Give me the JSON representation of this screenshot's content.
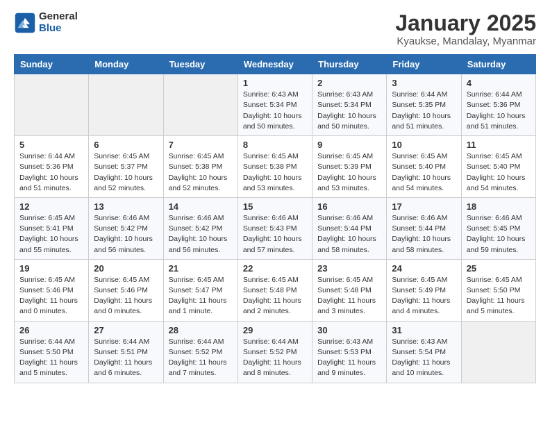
{
  "header": {
    "logo_general": "General",
    "logo_blue": "Blue",
    "month_year": "January 2025",
    "location": "Kyaukse, Mandalay, Myanmar"
  },
  "days_of_week": [
    "Sunday",
    "Monday",
    "Tuesday",
    "Wednesday",
    "Thursday",
    "Friday",
    "Saturday"
  ],
  "weeks": [
    [
      {
        "day": "",
        "info": ""
      },
      {
        "day": "",
        "info": ""
      },
      {
        "day": "",
        "info": ""
      },
      {
        "day": "1",
        "info": "Sunrise: 6:43 AM\nSunset: 5:34 PM\nDaylight: 10 hours\nand 50 minutes."
      },
      {
        "day": "2",
        "info": "Sunrise: 6:43 AM\nSunset: 5:34 PM\nDaylight: 10 hours\nand 50 minutes."
      },
      {
        "day": "3",
        "info": "Sunrise: 6:44 AM\nSunset: 5:35 PM\nDaylight: 10 hours\nand 51 minutes."
      },
      {
        "day": "4",
        "info": "Sunrise: 6:44 AM\nSunset: 5:36 PM\nDaylight: 10 hours\nand 51 minutes."
      }
    ],
    [
      {
        "day": "5",
        "info": "Sunrise: 6:44 AM\nSunset: 5:36 PM\nDaylight: 10 hours\nand 51 minutes."
      },
      {
        "day": "6",
        "info": "Sunrise: 6:45 AM\nSunset: 5:37 PM\nDaylight: 10 hours\nand 52 minutes."
      },
      {
        "day": "7",
        "info": "Sunrise: 6:45 AM\nSunset: 5:38 PM\nDaylight: 10 hours\nand 52 minutes."
      },
      {
        "day": "8",
        "info": "Sunrise: 6:45 AM\nSunset: 5:38 PM\nDaylight: 10 hours\nand 53 minutes."
      },
      {
        "day": "9",
        "info": "Sunrise: 6:45 AM\nSunset: 5:39 PM\nDaylight: 10 hours\nand 53 minutes."
      },
      {
        "day": "10",
        "info": "Sunrise: 6:45 AM\nSunset: 5:40 PM\nDaylight: 10 hours\nand 54 minutes."
      },
      {
        "day": "11",
        "info": "Sunrise: 6:45 AM\nSunset: 5:40 PM\nDaylight: 10 hours\nand 54 minutes."
      }
    ],
    [
      {
        "day": "12",
        "info": "Sunrise: 6:45 AM\nSunset: 5:41 PM\nDaylight: 10 hours\nand 55 minutes."
      },
      {
        "day": "13",
        "info": "Sunrise: 6:46 AM\nSunset: 5:42 PM\nDaylight: 10 hours\nand 56 minutes."
      },
      {
        "day": "14",
        "info": "Sunrise: 6:46 AM\nSunset: 5:42 PM\nDaylight: 10 hours\nand 56 minutes."
      },
      {
        "day": "15",
        "info": "Sunrise: 6:46 AM\nSunset: 5:43 PM\nDaylight: 10 hours\nand 57 minutes."
      },
      {
        "day": "16",
        "info": "Sunrise: 6:46 AM\nSunset: 5:44 PM\nDaylight: 10 hours\nand 58 minutes."
      },
      {
        "day": "17",
        "info": "Sunrise: 6:46 AM\nSunset: 5:44 PM\nDaylight: 10 hours\nand 58 minutes."
      },
      {
        "day": "18",
        "info": "Sunrise: 6:46 AM\nSunset: 5:45 PM\nDaylight: 10 hours\nand 59 minutes."
      }
    ],
    [
      {
        "day": "19",
        "info": "Sunrise: 6:45 AM\nSunset: 5:46 PM\nDaylight: 11 hours\nand 0 minutes."
      },
      {
        "day": "20",
        "info": "Sunrise: 6:45 AM\nSunset: 5:46 PM\nDaylight: 11 hours\nand 0 minutes."
      },
      {
        "day": "21",
        "info": "Sunrise: 6:45 AM\nSunset: 5:47 PM\nDaylight: 11 hours\nand 1 minute."
      },
      {
        "day": "22",
        "info": "Sunrise: 6:45 AM\nSunset: 5:48 PM\nDaylight: 11 hours\nand 2 minutes."
      },
      {
        "day": "23",
        "info": "Sunrise: 6:45 AM\nSunset: 5:48 PM\nDaylight: 11 hours\nand 3 minutes."
      },
      {
        "day": "24",
        "info": "Sunrise: 6:45 AM\nSunset: 5:49 PM\nDaylight: 11 hours\nand 4 minutes."
      },
      {
        "day": "25",
        "info": "Sunrise: 6:45 AM\nSunset: 5:50 PM\nDaylight: 11 hours\nand 5 minutes."
      }
    ],
    [
      {
        "day": "26",
        "info": "Sunrise: 6:44 AM\nSunset: 5:50 PM\nDaylight: 11 hours\nand 5 minutes."
      },
      {
        "day": "27",
        "info": "Sunrise: 6:44 AM\nSunset: 5:51 PM\nDaylight: 11 hours\nand 6 minutes."
      },
      {
        "day": "28",
        "info": "Sunrise: 6:44 AM\nSunset: 5:52 PM\nDaylight: 11 hours\nand 7 minutes."
      },
      {
        "day": "29",
        "info": "Sunrise: 6:44 AM\nSunset: 5:52 PM\nDaylight: 11 hours\nand 8 minutes."
      },
      {
        "day": "30",
        "info": "Sunrise: 6:43 AM\nSunset: 5:53 PM\nDaylight: 11 hours\nand 9 minutes."
      },
      {
        "day": "31",
        "info": "Sunrise: 6:43 AM\nSunset: 5:54 PM\nDaylight: 11 hours\nand 10 minutes."
      },
      {
        "day": "",
        "info": ""
      }
    ]
  ]
}
